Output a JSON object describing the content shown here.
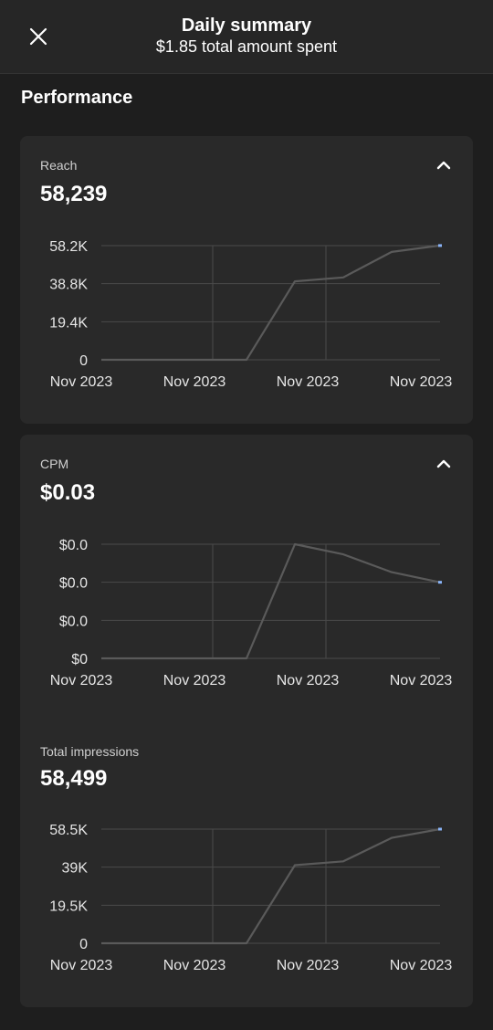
{
  "header": {
    "title": "Daily summary",
    "subtitle": "$1.85 total amount spent"
  },
  "section_title": "Performance",
  "colors": {
    "background": "#1e1e1e",
    "card": "#292929",
    "line": "#5a5a5a",
    "grid": "#4a4a4a",
    "endpoint": "#8ab4f8"
  },
  "cards": [
    {
      "label": "Reach",
      "value": "58,239",
      "collapse_icon": "chevron-up-icon"
    },
    {
      "label": "CPM",
      "value": "$0.03",
      "collapse_icon": "chevron-up-icon"
    },
    {
      "label": "Total impressions",
      "value": "58,499"
    }
  ],
  "chart_data": [
    {
      "type": "line",
      "title": "Reach",
      "x": [
        "Nov 2023",
        "Nov 2023",
        "Nov 2023",
        "Nov 2023"
      ],
      "y_ticks": [
        "0",
        "19.4K",
        "38.8K",
        "58.2K"
      ],
      "ylim": [
        0,
        58200
      ],
      "values": [
        0,
        0,
        0,
        0,
        40000,
        42000,
        55000,
        58239
      ],
      "grid": true
    },
    {
      "type": "line",
      "title": "CPM",
      "x": [
        "Nov 2023",
        "Nov 2023",
        "Nov 2023",
        "Nov 2023"
      ],
      "y_ticks": [
        "$0",
        "$0.0",
        "$0.0",
        "$0.0"
      ],
      "ylim": [
        0,
        0.045
      ],
      "values": [
        0,
        0,
        0,
        0,
        0.045,
        0.041,
        0.034,
        0.03
      ],
      "grid": true
    },
    {
      "type": "line",
      "title": "Total impressions",
      "x": [
        "Nov 2023",
        "Nov 2023",
        "Nov 2023",
        "Nov 2023"
      ],
      "y_ticks": [
        "0",
        "19.5K",
        "39K",
        "58.5K"
      ],
      "ylim": [
        0,
        58500
      ],
      "values": [
        0,
        0,
        0,
        0,
        40000,
        42000,
        54000,
        58499
      ],
      "grid": true
    }
  ]
}
